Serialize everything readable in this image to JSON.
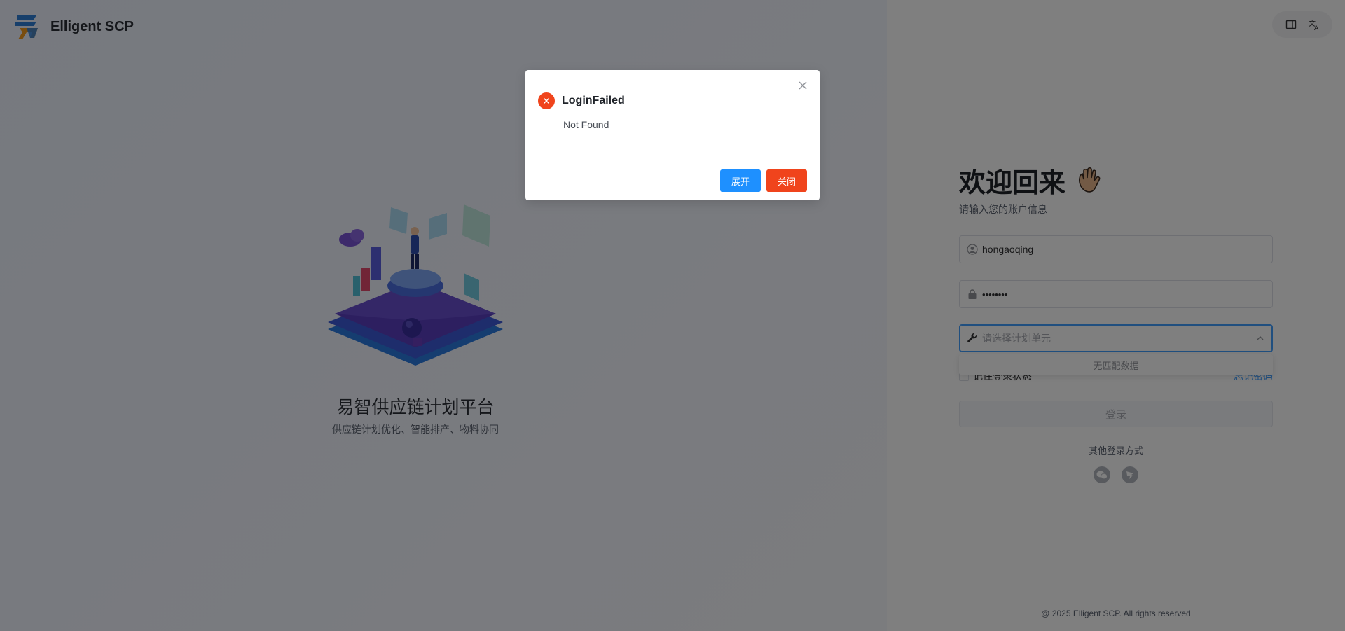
{
  "brand": {
    "name": "Elligent SCP"
  },
  "left": {
    "title": "易智供应链计划平台",
    "subtitle": "供应链计划优化、智能排产、物料协同"
  },
  "toolbar": {
    "items": [
      "layout-icon",
      "translate-icon"
    ]
  },
  "login": {
    "welcome": "欢迎回来",
    "welcome_sub": "请输入您的账户信息",
    "username": "hongaoqing",
    "password": "••••••••",
    "plan_unit_placeholder": "请选择计划单元",
    "dropdown_empty": "无匹配数据",
    "remember": "记住登录状态",
    "forgot": "忘记密码",
    "submit": "登录",
    "other_login": "其他登录方式"
  },
  "footer": {
    "copyright": "@ 2025 Elligent SCP. All rights reserved"
  },
  "dialog": {
    "title": "LoginFailed",
    "message": "Not Found",
    "expand_label": "展开",
    "close_label": "关闭"
  },
  "colors": {
    "primary": "#1e90ff",
    "danger": "#f0441c",
    "overlay": "rgba(0,0,0,0.5)"
  }
}
